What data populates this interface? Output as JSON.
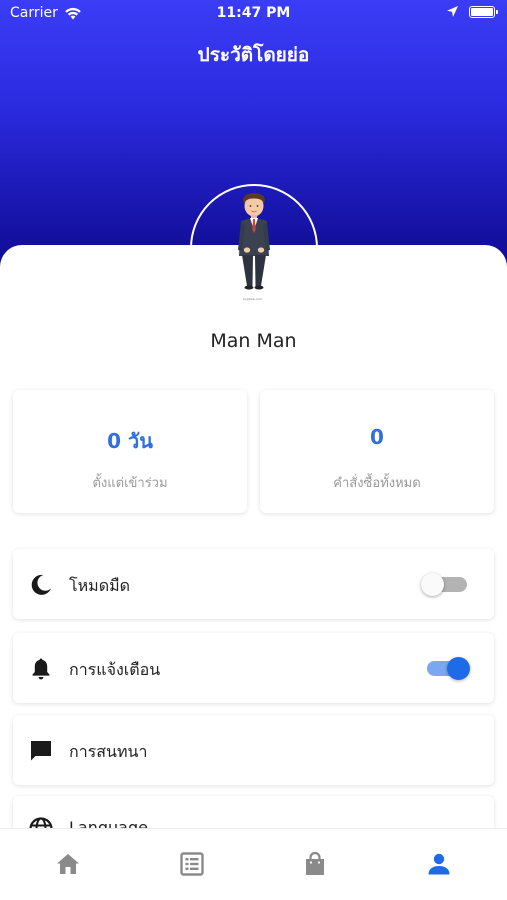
{
  "status_bar": {
    "carrier": "Carrier",
    "time": "11:47 PM"
  },
  "header": {
    "title": "ประวัติโดยย่อ"
  },
  "profile": {
    "name": "Man Man",
    "avatar_caption": "pngtree.com"
  },
  "stats": [
    {
      "value": "0 วัน",
      "label": "ตั้งแต่เข้าร่วม"
    },
    {
      "value": "0",
      "label": "คำสั่งซื้อทั้งหมด"
    }
  ],
  "settings": [
    {
      "label": "โหมดมืด",
      "icon": "moon-icon",
      "toggle": "off"
    },
    {
      "label": "การแจ้งเตือน",
      "icon": "bell-icon",
      "toggle": "on"
    },
    {
      "label": "การสนทนา",
      "icon": "chat-icon"
    },
    {
      "label": "Language",
      "icon": "globe-icon"
    }
  ],
  "tabbar": {
    "items": [
      "home-icon",
      "list-icon",
      "bag-icon",
      "person-icon"
    ],
    "active_index": 3
  },
  "colors": {
    "accent": "#2f6fde",
    "header_top": "#3b3df6",
    "header_bottom": "#0f0a8a",
    "tab_active": "#1f6ae6",
    "tab_inactive": "#8a8a8a"
  }
}
